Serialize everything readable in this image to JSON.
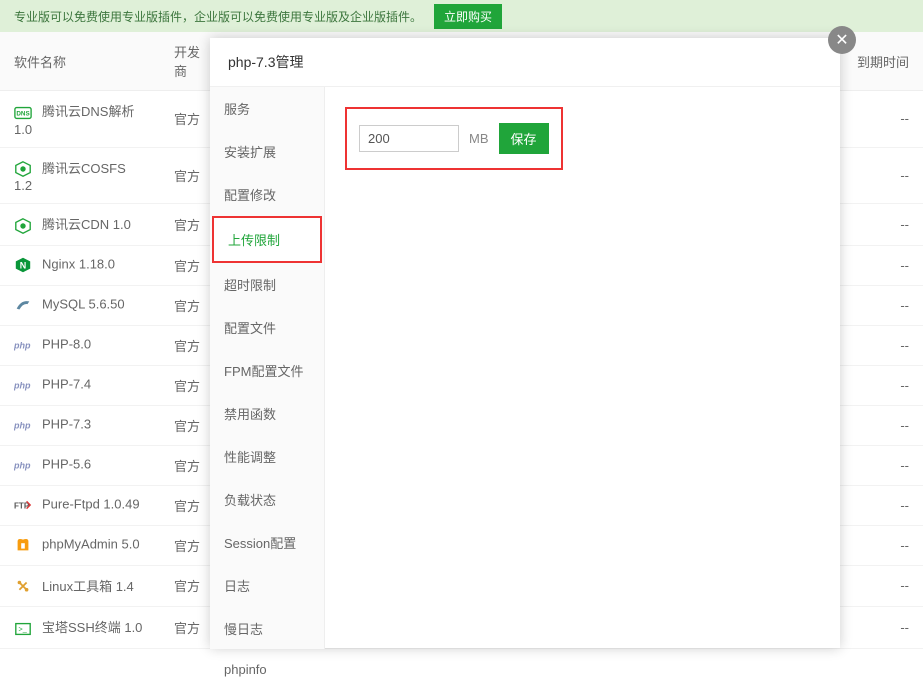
{
  "banner": {
    "text": "专业版可以免费使用专业版插件，企业版可以免费使用专业版及企业版插件。",
    "button": "立即购买"
  },
  "table": {
    "headers": {
      "name": "软件名称",
      "developer": "开发商",
      "expire": "到期时间"
    },
    "rows": [
      {
        "icon": "dns",
        "name": "腾讯云DNS解析 1.0",
        "developer": "官方",
        "expire": "--"
      },
      {
        "icon": "cosfs",
        "name": "腾讯云COSFS 1.2",
        "developer": "官方",
        "expire": "--"
      },
      {
        "icon": "cdn",
        "name": "腾讯云CDN 1.0",
        "developer": "官方",
        "expire": "--"
      },
      {
        "icon": "nginx",
        "name": "Nginx 1.18.0",
        "developer": "官方",
        "expire": "--"
      },
      {
        "icon": "mysql",
        "name": "MySQL 5.6.50",
        "developer": "官方",
        "expire": "--"
      },
      {
        "icon": "php",
        "name": "PHP-8.0",
        "developer": "官方",
        "expire": "--"
      },
      {
        "icon": "php",
        "name": "PHP-7.4",
        "developer": "官方",
        "expire": "--"
      },
      {
        "icon": "php",
        "name": "PHP-7.3",
        "developer": "官方",
        "expire": "--"
      },
      {
        "icon": "php",
        "name": "PHP-5.6",
        "developer": "官方",
        "expire": "--"
      },
      {
        "icon": "ftp",
        "name": "Pure-Ftpd 1.0.49",
        "developer": "官方",
        "expire": "--"
      },
      {
        "icon": "pma",
        "name": "phpMyAdmin 5.0",
        "developer": "官方",
        "expire": "--"
      },
      {
        "icon": "linux",
        "name": "Linux工具箱 1.4",
        "developer": "官方",
        "expire": "--"
      },
      {
        "icon": "ssh",
        "name": "宝塔SSH终端 1.0",
        "developer": "官方",
        "expire": "--"
      }
    ]
  },
  "dialog": {
    "title": "php-7.3管理",
    "nav": [
      "服务",
      "安装扩展",
      "配置修改",
      "上传限制",
      "超时限制",
      "配置文件",
      "FPM配置文件",
      "禁用函数",
      "性能调整",
      "负载状态",
      "Session配置",
      "日志",
      "慢日志",
      "phpinfo"
    ],
    "activeNavIndex": 3,
    "content": {
      "value": "200",
      "unit": "MB",
      "saveLabel": "保存"
    }
  }
}
